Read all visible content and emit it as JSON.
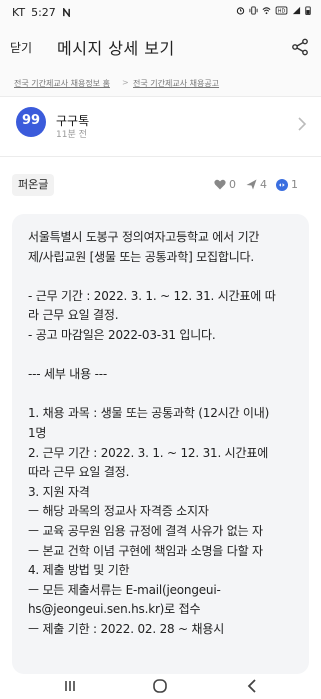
{
  "status_bar": {
    "carrier": "KT",
    "time": "5:27",
    "battery": "51%",
    "icons": [
      "n-icon",
      "alarm-icon",
      "vibrate-icon",
      "wifi-icon",
      "hd-icon",
      "signal-icon",
      "battery-icon"
    ]
  },
  "header": {
    "close_label": "닫기",
    "title": "메시지 상세 보기",
    "share_icon": "share-icon"
  },
  "breadcrumb": {
    "left": "전국 기간제교사 채용정보 홈",
    "right": "전국 기간제교사 채용공고"
  },
  "author": {
    "avatar_text": "99",
    "name": "구구톡",
    "time": "11분 전",
    "avatar_color": "#3b5bdb"
  },
  "post_meta": {
    "badge": "퍼온글",
    "likes": "0",
    "shares": "4",
    "views": "1"
  },
  "message": {
    "lines": [
      "서울특별시 도봉구 정의여자고등학교 에서 기간",
      "제/사립교원 [생물 또는 공통과학] 모집합니다.",
      "",
      "- 근무 기간 : 2022. 3. 1. ~ 12. 31. 시간표에 따",
      "라 근무 요일 결정.",
      "- 공고 마감일은 2022-03-31 입니다.",
      "",
      "--- 세부 내용 ---",
      "",
      "1. 채용 과목 : 생물 또는 공통과학 (12시간 이내)",
      "1명",
      "2. 근무 기간 : 2022. 3. 1. ~ 12. 31. 시간표에",
      "따라 근무 요일 결정.",
      "3. 지원 자격",
      "ㅡ 해당 과목의 정교사 자격증 소지자",
      "ㅡ 교육 공무원 임용 규정에 결격 사유가 없는 자",
      "ㅡ 본교 건학 이념 구현에 책임과 소명을 다할 자",
      "4. 제출 방법 및 기한",
      "ㅡ 모든 제출서류는 E-mail(jeongeui-",
      "hs@jeongeui.sen.hs.kr)로 접수",
      "ㅡ 제출 기한 : 2022. 02. 28 ~ 채용시"
    ]
  }
}
